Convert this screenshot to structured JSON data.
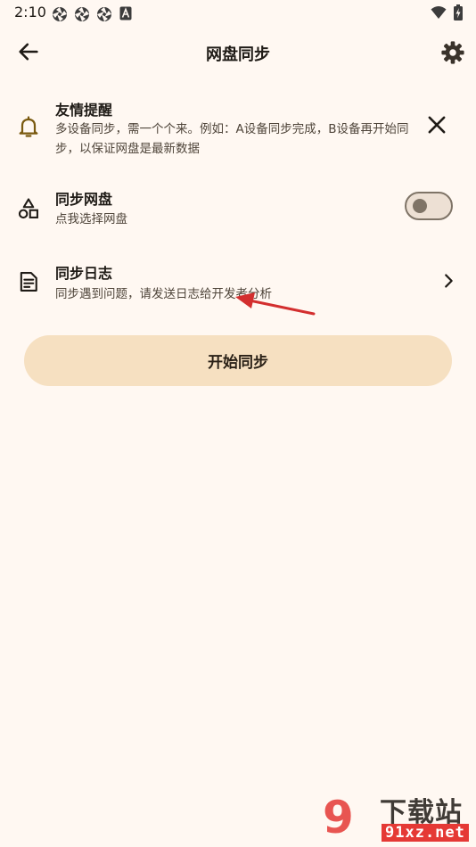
{
  "status_bar": {
    "time": "2:10",
    "notification_icons": [
      "aperture-icon",
      "aperture-icon",
      "aperture-icon",
      "font-a-icon"
    ],
    "system_icons": [
      "wifi-icon",
      "battery-charging-icon"
    ]
  },
  "app_bar": {
    "title": "网盘同步",
    "back_icon": "arrow-left-icon",
    "settings_icon": "gear-icon"
  },
  "tip": {
    "title": "友情提醒",
    "body": "多设备同步，需一个个来。例如：A设备同步完成，B设备再开始同步，以保证网盘是最新数据",
    "icon": "bell-icon",
    "close_icon": "close-icon"
  },
  "disk": {
    "title": "同步网盘",
    "subtitle": "点我选择网盘",
    "icon": "shapes-icon",
    "toggle_on": false
  },
  "log": {
    "title": "同步日志",
    "subtitle": "同步遇到问题，请发送日志给开发者分析",
    "icon": "document-icon",
    "chevron_icon": "chevron-right-icon"
  },
  "start_button": {
    "label": "开始同步"
  },
  "watermark": {
    "badge": "9",
    "brand": "下载站",
    "url": "91xz.net"
  },
  "colors": {
    "background": "#FFF8F2",
    "button_fill": "#F6E0C1",
    "bell_icon": "#7A5A10",
    "toggle_outline": "#7F7467",
    "annotation_arrow": "#D32F2F"
  }
}
